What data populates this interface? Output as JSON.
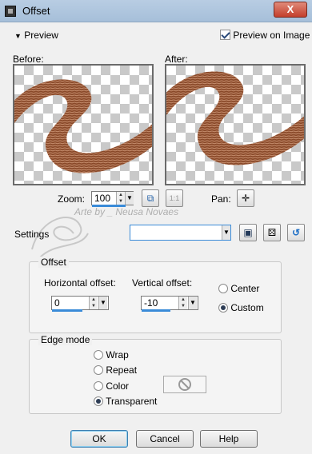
{
  "window": {
    "title": "Offset",
    "close_label": "X"
  },
  "preview_section": {
    "toggle_label": "Preview",
    "preview_on_image_label": "Preview on Image",
    "preview_on_image_checked": true
  },
  "before_label": "Before:",
  "after_label": "After:",
  "zoom": {
    "label": "Zoom:",
    "value": "100",
    "one_to_one_label": "1:1"
  },
  "pan": {
    "label": "Pan:"
  },
  "watermark_text": "Arte by _ Neusa Novaes",
  "settings": {
    "label": "Settings",
    "value": ""
  },
  "offset_group": {
    "title": "Offset",
    "horizontal_label": "Horizontal offset:",
    "horizontal_value": "0",
    "vertical_label": "Vertical offset:",
    "vertical_value": "-10",
    "options": [
      {
        "label": "Center",
        "selected": false
      },
      {
        "label": "Custom",
        "selected": true
      }
    ]
  },
  "edge_mode": {
    "title": "Edge mode",
    "options": [
      {
        "label": "Wrap",
        "selected": false
      },
      {
        "label": "Repeat",
        "selected": false
      },
      {
        "label": "Color",
        "selected": false
      },
      {
        "label": "Transparent",
        "selected": true
      }
    ]
  },
  "buttons": {
    "ok": "OK",
    "cancel": "Cancel",
    "help": "Help"
  },
  "colors": {
    "accent": "#3a8bd8",
    "brown": "#8a4a2a"
  }
}
